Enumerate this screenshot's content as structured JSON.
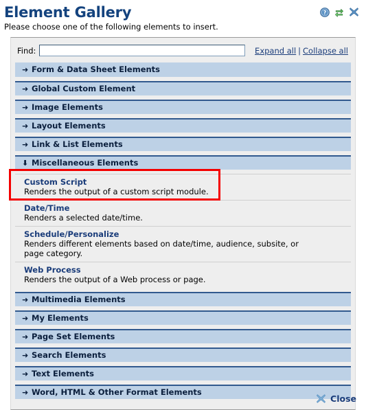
{
  "header": {
    "title": "Element Gallery",
    "subtitle": "Please choose one of the following elements to insert.",
    "icons": [
      {
        "name": "help-icon",
        "glyph": "?"
      },
      {
        "name": "refresh-icon",
        "glyph": "⇄"
      },
      {
        "name": "close-icon",
        "glyph": "✕"
      }
    ]
  },
  "search": {
    "label": "Find:",
    "value": "",
    "placeholder": "",
    "expand_all": "Expand all",
    "separator": "|",
    "collapse_all": "Collapse all"
  },
  "arrows": {
    "collapsed": "➜",
    "expanded": "⬇"
  },
  "sections": [
    {
      "label": "Form & Data Sheet Elements",
      "expanded": false,
      "items": []
    },
    {
      "label": "Global Custom Element",
      "expanded": false,
      "items": []
    },
    {
      "label": "Image Elements",
      "expanded": false,
      "items": []
    },
    {
      "label": "Layout Elements",
      "expanded": false,
      "items": []
    },
    {
      "label": "Link & List Elements",
      "expanded": false,
      "items": []
    },
    {
      "label": "Miscellaneous Elements",
      "expanded": true,
      "items": [
        {
          "title": "Custom Script",
          "desc": "Renders the output of a custom script module."
        },
        {
          "title": "Date/Time",
          "desc": "Renders a selected date/time."
        },
        {
          "title": "Schedule/Personalize",
          "desc": "Renders different elements based on date/time, audience, subsite, or page category."
        },
        {
          "title": "Web Process",
          "desc": "Renders the output of a Web process or page."
        }
      ]
    },
    {
      "label": "Multimedia Elements",
      "expanded": false,
      "items": []
    },
    {
      "label": "My Elements",
      "expanded": false,
      "items": []
    },
    {
      "label": "Page Set Elements",
      "expanded": false,
      "items": []
    },
    {
      "label": "Search Elements",
      "expanded": false,
      "items": []
    },
    {
      "label": "Text Elements",
      "expanded": false,
      "items": []
    },
    {
      "label": "Word, HTML & Other Format Elements",
      "expanded": false,
      "items": []
    }
  ],
  "footer": {
    "close_label": "Close"
  },
  "annotation": {
    "highlight_color": "#f40000",
    "highlight_target": "Custom Script"
  },
  "colors": {
    "title": "#14437e",
    "header_bar": "#bdd1e6",
    "header_bar_border": "#31598e",
    "panel_bg": "#eeeeee",
    "link": "#1a3c7a"
  }
}
